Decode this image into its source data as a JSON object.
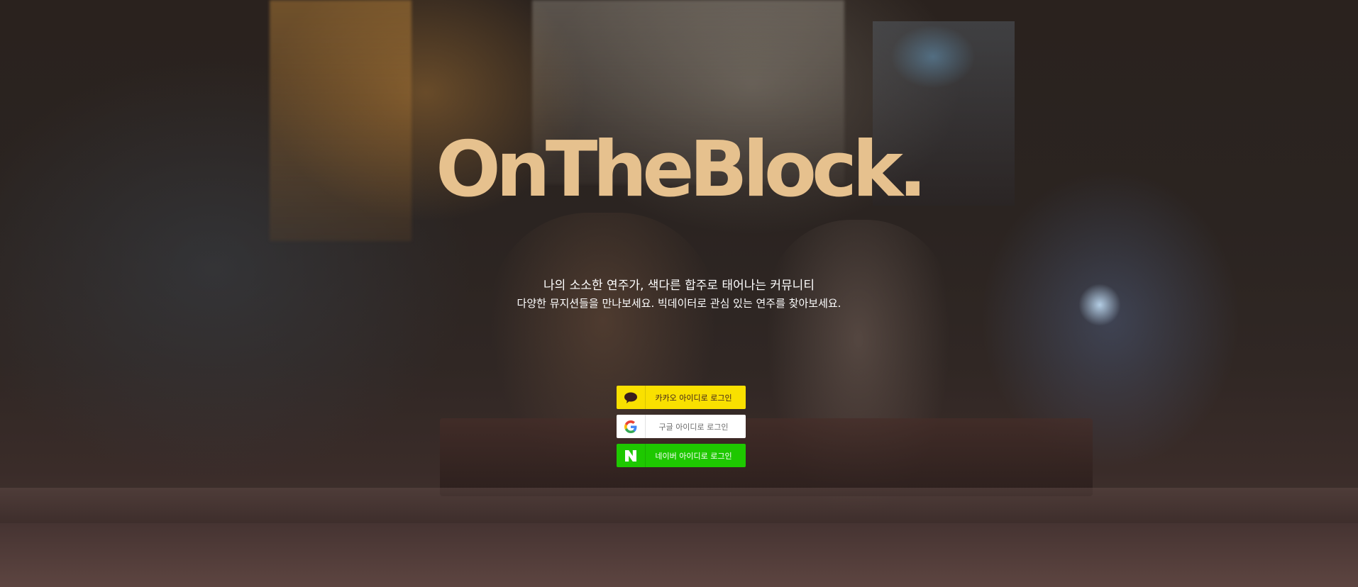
{
  "brand": {
    "logo_text": "OnTheBlock.",
    "logo_color": "#e6c18e"
  },
  "hero": {
    "tagline_primary": "나의 소소한 연주가, 색다른 합주로 태어나는 커뮤니티",
    "tagline_secondary": "다양한 뮤지션들을 만나보세요. 빅데이터로 관심 있는 연주를 찾아보세요."
  },
  "login": {
    "kakao": {
      "label": "카카오 아이디로 로그인",
      "icon": "speech-bubble-icon",
      "color": "#f9e000"
    },
    "google": {
      "label": "구글 아이디로 로그인",
      "icon": "google-g-icon",
      "color": "#ffffff"
    },
    "naver": {
      "label": "네이버 아이디로 로그인",
      "icon": "naver-n-icon",
      "color": "#1ec800"
    }
  }
}
